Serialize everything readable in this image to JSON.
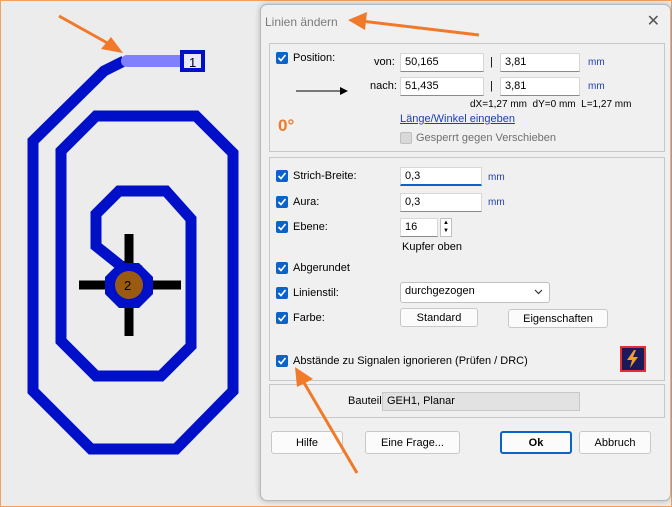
{
  "dialog": {
    "title": "Linien ändern",
    "close_symbol": "✕"
  },
  "position": {
    "label": "Position:",
    "von_label": "von:",
    "von_x": "50,165",
    "von_y": "3,81",
    "nach_label": "nach:",
    "nach_x": "51,435",
    "nach_y": "3,81",
    "separator": "|",
    "unit": "mm",
    "deltas": "dX=1,27 mm  dY=0 mm  L=1,27 mm",
    "angle": "0°",
    "length_angle_link": "Länge/Winkel eingeben",
    "lock_label": "Gesperrt gegen Verschieben"
  },
  "props": {
    "strich_label": "Strich-Breite:",
    "strich_value": "0,3",
    "aura_label": "Aura:",
    "aura_value": "0,3",
    "ebene_label": "Ebene:",
    "ebene_value": "16",
    "ebene_name": "Kupfer oben",
    "abgerundet_label": "Abgerundet",
    "linienstil_label": "Linienstil:",
    "linienstil_value": "durchgezogen",
    "farbe_label": "Farbe:",
    "standard_button": "Standard",
    "eigenschaften_button": "Eigenschaften",
    "unit": "mm",
    "abstaende_label": "Abstände zu Signalen ignorieren (Prüfen / DRC)"
  },
  "bauteil": {
    "label": "Bauteil:",
    "value": "GEH1, Planar"
  },
  "buttons": {
    "hilfe": "Hilfe",
    "frage": "Eine Frage...",
    "ok": "Ok",
    "abbruch": "Abbruch"
  },
  "pcb": {
    "pad1_label": "1",
    "pad2_label": "2"
  },
  "colors": {
    "trace": "#0010c8",
    "selected_trace": "#8080ff",
    "pad2": "#9a5a10",
    "accent_orange": "#f07a2a",
    "check_blue": "#0a63c9"
  }
}
